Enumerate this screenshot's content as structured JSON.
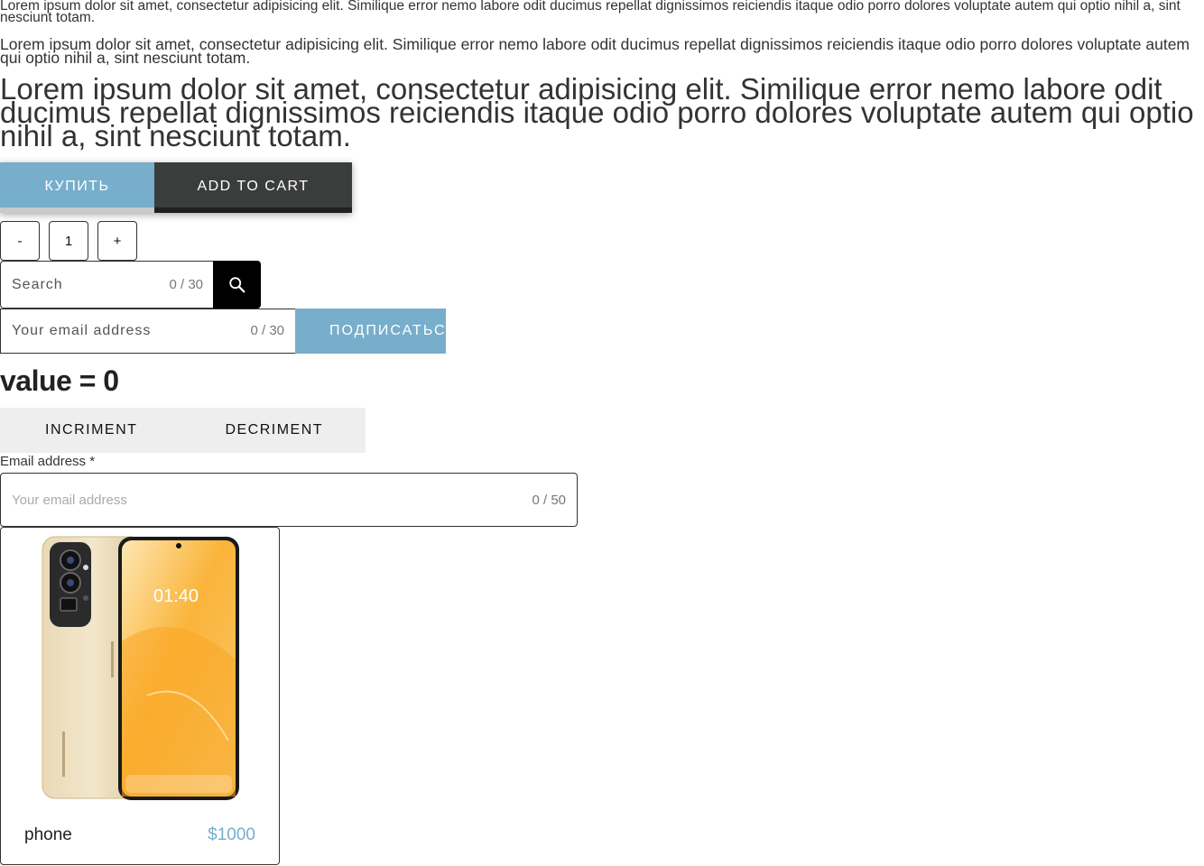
{
  "paragraphs": {
    "small": "Lorem ipsum dolor sit amet, consectetur adipisicing elit. Similique error nemo labore odit ducimus repellat dignissimos reiciendis itaque odio porro dolores voluptate autem qui optio nihil a, sint nesciunt totam.",
    "medium": "Lorem ipsum dolor sit amet, consectetur adipisicing elit. Similique error nemo labore odit ducimus repellat dignissimos reiciendis itaque odio porro dolores voluptate autem qui optio nihil a, sint nesciunt totam.",
    "large": "Lorem ipsum dolor sit amet, consectetur adipisicing elit. Similique error nemo labore odit ducimus repellat dignissimos reiciendis itaque odio porro dolores voluptate autem qui optio nihil a, sint nesciunt totam."
  },
  "buttons": {
    "buy_label": "КУПИТЬ",
    "add_to_cart_label": "ADD TO CART"
  },
  "stepper": {
    "minus_label": "-",
    "value": "1",
    "plus_label": "+"
  },
  "search": {
    "placeholder": "Search",
    "counter": "0 / 30",
    "icon": "search-icon"
  },
  "subscribe": {
    "placeholder": "Your email address",
    "counter": "0 / 30",
    "button_label": "ПОДПИСАТЬСЯ"
  },
  "counter": {
    "value_text": "value = 0",
    "increment_label": "INCRIMENT",
    "decrement_label": "DECRIMENT"
  },
  "email_field": {
    "label": "Email address *",
    "placeholder": "Your email address",
    "counter": "0 / 50"
  },
  "product": {
    "name": "phone",
    "price": "$1000",
    "screen_time": "01:40"
  },
  "colors": {
    "accent": "#77aecb",
    "dark": "#3b3d3c",
    "text": "#333333"
  }
}
